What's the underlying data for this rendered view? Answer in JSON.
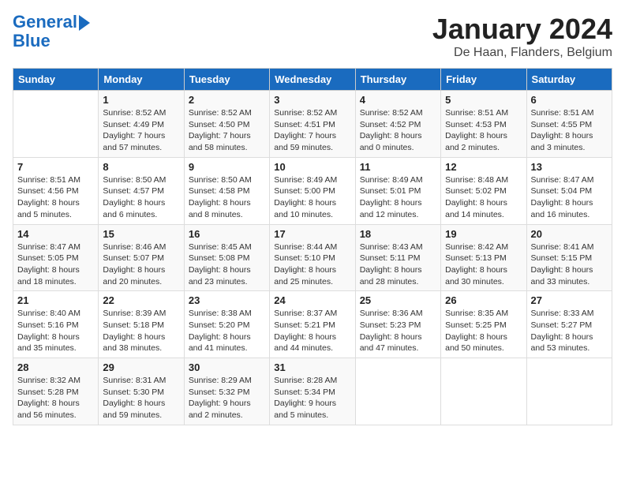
{
  "logo": {
    "line1": "General",
    "line2": "Blue"
  },
  "title": "January 2024",
  "location": "De Haan, Flanders, Belgium",
  "days_header": [
    "Sunday",
    "Monday",
    "Tuesday",
    "Wednesday",
    "Thursday",
    "Friday",
    "Saturday"
  ],
  "weeks": [
    [
      {
        "num": "",
        "sunrise": "",
        "sunset": "",
        "daylight": ""
      },
      {
        "num": "1",
        "sunrise": "Sunrise: 8:52 AM",
        "sunset": "Sunset: 4:49 PM",
        "daylight": "Daylight: 7 hours and 57 minutes."
      },
      {
        "num": "2",
        "sunrise": "Sunrise: 8:52 AM",
        "sunset": "Sunset: 4:50 PM",
        "daylight": "Daylight: 7 hours and 58 minutes."
      },
      {
        "num": "3",
        "sunrise": "Sunrise: 8:52 AM",
        "sunset": "Sunset: 4:51 PM",
        "daylight": "Daylight: 7 hours and 59 minutes."
      },
      {
        "num": "4",
        "sunrise": "Sunrise: 8:52 AM",
        "sunset": "Sunset: 4:52 PM",
        "daylight": "Daylight: 8 hours and 0 minutes."
      },
      {
        "num": "5",
        "sunrise": "Sunrise: 8:51 AM",
        "sunset": "Sunset: 4:53 PM",
        "daylight": "Daylight: 8 hours and 2 minutes."
      },
      {
        "num": "6",
        "sunrise": "Sunrise: 8:51 AM",
        "sunset": "Sunset: 4:55 PM",
        "daylight": "Daylight: 8 hours and 3 minutes."
      }
    ],
    [
      {
        "num": "7",
        "sunrise": "Sunrise: 8:51 AM",
        "sunset": "Sunset: 4:56 PM",
        "daylight": "Daylight: 8 hours and 5 minutes."
      },
      {
        "num": "8",
        "sunrise": "Sunrise: 8:50 AM",
        "sunset": "Sunset: 4:57 PM",
        "daylight": "Daylight: 8 hours and 6 minutes."
      },
      {
        "num": "9",
        "sunrise": "Sunrise: 8:50 AM",
        "sunset": "Sunset: 4:58 PM",
        "daylight": "Daylight: 8 hours and 8 minutes."
      },
      {
        "num": "10",
        "sunrise": "Sunrise: 8:49 AM",
        "sunset": "Sunset: 5:00 PM",
        "daylight": "Daylight: 8 hours and 10 minutes."
      },
      {
        "num": "11",
        "sunrise": "Sunrise: 8:49 AM",
        "sunset": "Sunset: 5:01 PM",
        "daylight": "Daylight: 8 hours and 12 minutes."
      },
      {
        "num": "12",
        "sunrise": "Sunrise: 8:48 AM",
        "sunset": "Sunset: 5:02 PM",
        "daylight": "Daylight: 8 hours and 14 minutes."
      },
      {
        "num": "13",
        "sunrise": "Sunrise: 8:47 AM",
        "sunset": "Sunset: 5:04 PM",
        "daylight": "Daylight: 8 hours and 16 minutes."
      }
    ],
    [
      {
        "num": "14",
        "sunrise": "Sunrise: 8:47 AM",
        "sunset": "Sunset: 5:05 PM",
        "daylight": "Daylight: 8 hours and 18 minutes."
      },
      {
        "num": "15",
        "sunrise": "Sunrise: 8:46 AM",
        "sunset": "Sunset: 5:07 PM",
        "daylight": "Daylight: 8 hours and 20 minutes."
      },
      {
        "num": "16",
        "sunrise": "Sunrise: 8:45 AM",
        "sunset": "Sunset: 5:08 PM",
        "daylight": "Daylight: 8 hours and 23 minutes."
      },
      {
        "num": "17",
        "sunrise": "Sunrise: 8:44 AM",
        "sunset": "Sunset: 5:10 PM",
        "daylight": "Daylight: 8 hours and 25 minutes."
      },
      {
        "num": "18",
        "sunrise": "Sunrise: 8:43 AM",
        "sunset": "Sunset: 5:11 PM",
        "daylight": "Daylight: 8 hours and 28 minutes."
      },
      {
        "num": "19",
        "sunrise": "Sunrise: 8:42 AM",
        "sunset": "Sunset: 5:13 PM",
        "daylight": "Daylight: 8 hours and 30 minutes."
      },
      {
        "num": "20",
        "sunrise": "Sunrise: 8:41 AM",
        "sunset": "Sunset: 5:15 PM",
        "daylight": "Daylight: 8 hours and 33 minutes."
      }
    ],
    [
      {
        "num": "21",
        "sunrise": "Sunrise: 8:40 AM",
        "sunset": "Sunset: 5:16 PM",
        "daylight": "Daylight: 8 hours and 35 minutes."
      },
      {
        "num": "22",
        "sunrise": "Sunrise: 8:39 AM",
        "sunset": "Sunset: 5:18 PM",
        "daylight": "Daylight: 8 hours and 38 minutes."
      },
      {
        "num": "23",
        "sunrise": "Sunrise: 8:38 AM",
        "sunset": "Sunset: 5:20 PM",
        "daylight": "Daylight: 8 hours and 41 minutes."
      },
      {
        "num": "24",
        "sunrise": "Sunrise: 8:37 AM",
        "sunset": "Sunset: 5:21 PM",
        "daylight": "Daylight: 8 hours and 44 minutes."
      },
      {
        "num": "25",
        "sunrise": "Sunrise: 8:36 AM",
        "sunset": "Sunset: 5:23 PM",
        "daylight": "Daylight: 8 hours and 47 minutes."
      },
      {
        "num": "26",
        "sunrise": "Sunrise: 8:35 AM",
        "sunset": "Sunset: 5:25 PM",
        "daylight": "Daylight: 8 hours and 50 minutes."
      },
      {
        "num": "27",
        "sunrise": "Sunrise: 8:33 AM",
        "sunset": "Sunset: 5:27 PM",
        "daylight": "Daylight: 8 hours and 53 minutes."
      }
    ],
    [
      {
        "num": "28",
        "sunrise": "Sunrise: 8:32 AM",
        "sunset": "Sunset: 5:28 PM",
        "daylight": "Daylight: 8 hours and 56 minutes."
      },
      {
        "num": "29",
        "sunrise": "Sunrise: 8:31 AM",
        "sunset": "Sunset: 5:30 PM",
        "daylight": "Daylight: 8 hours and 59 minutes."
      },
      {
        "num": "30",
        "sunrise": "Sunrise: 8:29 AM",
        "sunset": "Sunset: 5:32 PM",
        "daylight": "Daylight: 9 hours and 2 minutes."
      },
      {
        "num": "31",
        "sunrise": "Sunrise: 8:28 AM",
        "sunset": "Sunset: 5:34 PM",
        "daylight": "Daylight: 9 hours and 5 minutes."
      },
      {
        "num": "",
        "sunrise": "",
        "sunset": "",
        "daylight": ""
      },
      {
        "num": "",
        "sunrise": "",
        "sunset": "",
        "daylight": ""
      },
      {
        "num": "",
        "sunrise": "",
        "sunset": "",
        "daylight": ""
      }
    ]
  ]
}
